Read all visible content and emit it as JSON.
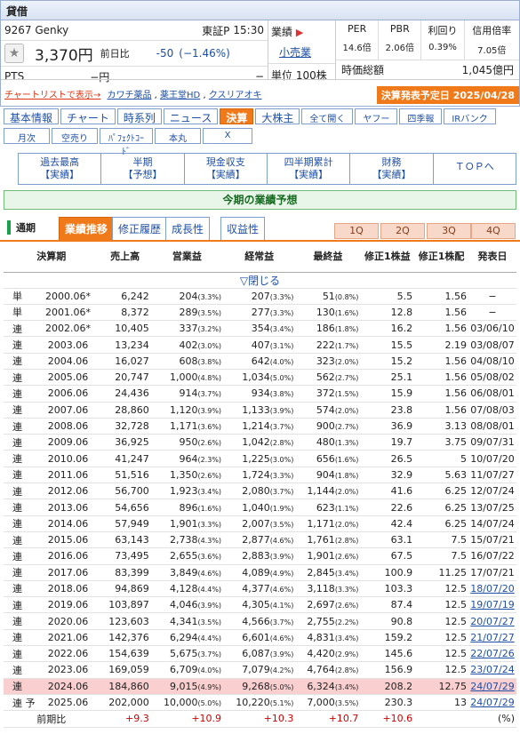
{
  "header": {
    "title": "貸借"
  },
  "stock": {
    "code_name": "9267 Genky",
    "market": "東証P",
    "time": "15:30",
    "price": "3,370円",
    "change_label": "前日比",
    "change": "-50",
    "change_pct": "(−1.46%)",
    "pts_label": "PTS",
    "pts_value": "−円",
    "pts_tail": "−"
  },
  "industry": {
    "label": "業績",
    "value": "小売業",
    "unit_label": "単位",
    "unit_value": "100株"
  },
  "metrics": {
    "per_label": "PER",
    "per": "14.6倍",
    "pbr_label": "PBR",
    "pbr": "2.06倍",
    "yield_label": "利回り",
    "yield": "0.39%",
    "margin_label": "信用倍率",
    "margin": "7.05倍",
    "mcap_label": "時価総額",
    "mcap": "1,045億円"
  },
  "links": {
    "watch": "チャートリストで表示→",
    "peer1": "カワチ薬品",
    "peer2": "薬王堂HD",
    "peer3": "クスリアオキ",
    "announce": "決算発表予定日 2025/04/28"
  },
  "tabs1": [
    "基本情報",
    "チャート",
    "時系列",
    "ニュース",
    "決算",
    "大株主",
    "全て開く",
    "ヤフー",
    "四季報",
    "IRバンク"
  ],
  "tabs2": [
    "月次",
    "空売り",
    "ﾊﾟﾌｪｸﾄｺｰﾄﾞ",
    "本丸",
    "X"
  ],
  "nav": [
    [
      "過去最高",
      "【実績】"
    ],
    [
      "半期",
      "【予想】"
    ],
    [
      "現金収支",
      "【実績】"
    ],
    [
      "四半期累計",
      "【実績】"
    ],
    [
      "財務",
      "【実績】"
    ],
    [
      "ＴＯＰへ",
      ""
    ]
  ],
  "section_title": "今期の業績予想",
  "subtabs": {
    "label": "通期",
    "items": [
      "業績推移",
      "修正履歴",
      "成長性",
      "収益性"
    ],
    "quarters": [
      "1Q",
      "2Q",
      "3Q",
      "4Q"
    ]
  },
  "table": {
    "headers": [
      "決算期",
      "売上高",
      "営業益",
      "経常益",
      "最終益",
      "修正1株益",
      "修正1株配",
      "発表日"
    ],
    "close_label": "▽閉じる",
    "rows": [
      [
        "単",
        "2000.06*",
        "6,242",
        "204",
        "(3.3%)",
        "207",
        "(3.3%)",
        "51",
        "(0.8%)",
        "5.5",
        "1.56",
        "−"
      ],
      [
        "単",
        "2001.06*",
        "8,372",
        "289",
        "(3.5%)",
        "277",
        "(3.3%)",
        "130",
        "(1.6%)",
        "12.8",
        "1.56",
        "−"
      ],
      [
        "連",
        "2002.06*",
        "10,405",
        "337",
        "(3.2%)",
        "354",
        "(3.4%)",
        "186",
        "(1.8%)",
        "16.2",
        "1.56",
        "03/06/10"
      ],
      [
        "連",
        "2003.06",
        "13,234",
        "402",
        "(3.0%)",
        "407",
        "(3.1%)",
        "222",
        "(1.7%)",
        "15.5",
        "2.19",
        "03/08/07"
      ],
      [
        "連",
        "2004.06",
        "16,027",
        "608",
        "(3.8%)",
        "642",
        "(4.0%)",
        "323",
        "(2.0%)",
        "15.2",
        "1.56",
        "04/08/10"
      ],
      [
        "連",
        "2005.06",
        "20,747",
        "1,000",
        "(4.8%)",
        "1,034",
        "(5.0%)",
        "562",
        "(2.7%)",
        "25.1",
        "1.56",
        "05/08/02"
      ],
      [
        "連",
        "2006.06",
        "24,436",
        "914",
        "(3.7%)",
        "934",
        "(3.8%)",
        "372",
        "(1.5%)",
        "15.9",
        "1.56",
        "06/08/01"
      ],
      [
        "連",
        "2007.06",
        "28,860",
        "1,120",
        "(3.9%)",
        "1,133",
        "(3.9%)",
        "574",
        "(2.0%)",
        "23.8",
        "1.56",
        "07/08/03"
      ],
      [
        "連",
        "2008.06",
        "32,728",
        "1,171",
        "(3.6%)",
        "1,214",
        "(3.7%)",
        "900",
        "(2.7%)",
        "36.9",
        "3.13",
        "08/08/01"
      ],
      [
        "連",
        "2009.06",
        "36,925",
        "950",
        "(2.6%)",
        "1,042",
        "(2.8%)",
        "480",
        "(1.3%)",
        "19.7",
        "3.75",
        "09/07/31"
      ],
      [
        "連",
        "2010.06",
        "41,247",
        "964",
        "(2.3%)",
        "1,225",
        "(3.0%)",
        "656",
        "(1.6%)",
        "26.5",
        "5",
        "10/07/20"
      ],
      [
        "連",
        "2011.06",
        "51,516",
        "1,350",
        "(2.6%)",
        "1,724",
        "(3.3%)",
        "904",
        "(1.8%)",
        "32.9",
        "5.63",
        "11/07/27"
      ],
      [
        "連",
        "2012.06",
        "56,700",
        "1,923",
        "(3.4%)",
        "2,080",
        "(3.7%)",
        "1,144",
        "(2.0%)",
        "41.6",
        "6.25",
        "12/07/24"
      ],
      [
        "連",
        "2013.06",
        "54,656",
        "896",
        "(1.6%)",
        "1,040",
        "(1.9%)",
        "623",
        "(1.1%)",
        "22.6",
        "6.25",
        "13/07/25"
      ],
      [
        "連",
        "2014.06",
        "57,949",
        "1,901",
        "(3.3%)",
        "2,007",
        "(3.5%)",
        "1,171",
        "(2.0%)",
        "42.4",
        "6.25",
        "14/07/24"
      ],
      [
        "連",
        "2015.06",
        "63,143",
        "2,738",
        "(4.3%)",
        "2,877",
        "(4.6%)",
        "1,761",
        "(2.8%)",
        "63.1",
        "7.5",
        "15/07/21"
      ],
      [
        "連",
        "2016.06",
        "73,495",
        "2,655",
        "(3.6%)",
        "2,883",
        "(3.9%)",
        "1,901",
        "(2.6%)",
        "67.5",
        "7.5",
        "16/07/22"
      ],
      [
        "連",
        "2017.06",
        "83,399",
        "3,849",
        "(4.6%)",
        "4,089",
        "(4.9%)",
        "2,845",
        "(3.4%)",
        "100.9",
        "11.25",
        "17/07/21"
      ],
      [
        "連",
        "2018.06",
        "94,869",
        "4,128",
        "(4.4%)",
        "4,377",
        "(4.6%)",
        "3,118",
        "(3.3%)",
        "103.3",
        "12.5",
        "18/07/20"
      ],
      [
        "連",
        "2019.06",
        "103,897",
        "4,046",
        "(3.9%)",
        "4,305",
        "(4.1%)",
        "2,697",
        "(2.6%)",
        "87.4",
        "12.5",
        "19/07/19"
      ],
      [
        "連",
        "2020.06",
        "123,603",
        "4,341",
        "(3.5%)",
        "4,566",
        "(3.7%)",
        "2,755",
        "(2.2%)",
        "90.8",
        "12.5",
        "20/07/27"
      ],
      [
        "連",
        "2021.06",
        "142,376",
        "6,294",
        "(4.4%)",
        "6,601",
        "(4.6%)",
        "4,831",
        "(3.4%)",
        "159.2",
        "12.5",
        "21/07/27"
      ],
      [
        "連",
        "2022.06",
        "154,639",
        "5,675",
        "(3.7%)",
        "6,087",
        "(3.9%)",
        "4,420",
        "(2.9%)",
        "145.6",
        "12.5",
        "22/07/26"
      ],
      [
        "連",
        "2023.06",
        "169,059",
        "6,709",
        "(4.0%)",
        "7,079",
        "(4.2%)",
        "4,764",
        "(2.8%)",
        "156.9",
        "12.5",
        "23/07/24"
      ],
      [
        "連",
        "2024.06",
        "184,860",
        "9,015",
        "(4.9%)",
        "9,268",
        "(5.0%)",
        "6,324",
        "(3.4%)",
        "208.2",
        "12.75",
        "24/07/29"
      ],
      [
        "連 予",
        "2025.06",
        "202,000",
        "10,000",
        "(5.0%)",
        "10,220",
        "(5.1%)",
        "7,000",
        "(3.5%)",
        "230.3",
        "13",
        "24/07/29"
      ]
    ],
    "prev_ratio": {
      "label": "前期比",
      "values": [
        "+9.3",
        "+10.9",
        "+10.3",
        "+10.7",
        "+10.6"
      ],
      "unit": "(%)"
    }
  },
  "colors": {
    "accent": "#f07a1a",
    "link": "#1e4fa6",
    "highlight_row": "#f9cfd0",
    "section_green": "#176b20"
  }
}
